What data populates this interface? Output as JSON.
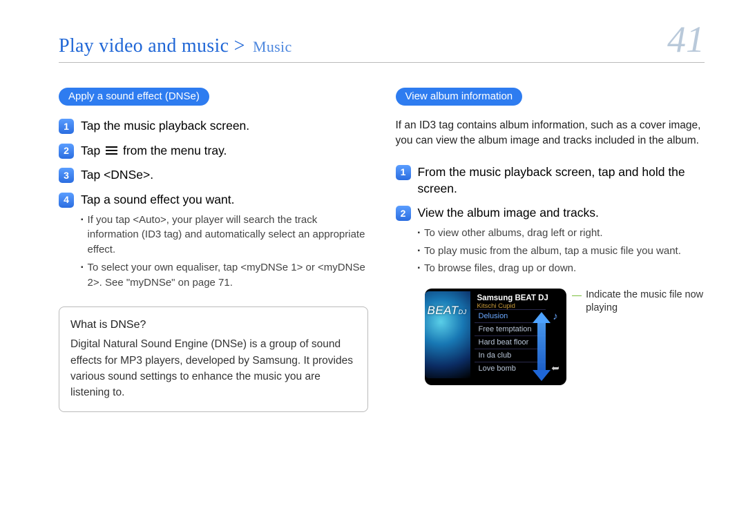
{
  "header": {
    "breadcrumb_main": "Play video and music >",
    "breadcrumb_sub": "Music",
    "page_number": "41"
  },
  "left": {
    "section_title": "Apply a sound effect (DNSe)",
    "steps": [
      {
        "text": "Tap the music playback screen."
      },
      {
        "pre": "Tap",
        "post": "from the menu tray.",
        "has_icon": true
      },
      {
        "text": "Tap <DNSe>."
      },
      {
        "text": "Tap a sound effect you want."
      }
    ],
    "step4_bullets": [
      "If you tap <Auto>, your player will search the track information (ID3 tag) and automatically select an appropriate effect.",
      "To select your own equaliser, tap <myDNSe 1> or <myDNSe 2>. See \"myDNSe\" on page 71."
    ],
    "note": {
      "title": "What is DNSe?",
      "body": "Digital Natural Sound Engine (DNSe) is a group of sound effects for MP3 players, developed by Samsung. It provides various sound settings to enhance the music you are listening to."
    }
  },
  "right": {
    "section_title": "View album information",
    "intro": "If an ID3 tag contains album information, such as a cover image, you can view the album image and tracks included in the album.",
    "steps": [
      {
        "text": "From the music playback screen, tap and hold the screen."
      },
      {
        "text": "View the album image and tracks."
      }
    ],
    "step2_bullets": [
      "To view other albums, drag left or right.",
      "To play music from the album, tap a music file you want.",
      "To browse files, drag up or down."
    ],
    "device": {
      "title": "Samsung BEAT DJ",
      "artist": "Kitschi Cupid",
      "logo": "BEAT",
      "logo_suffix": "DJ",
      "tracks": [
        "Delusion",
        "Free temptation",
        "Hard beat floor",
        "In da club",
        "Love bomb"
      ],
      "selected_index": 0
    },
    "callout": "Indicate the music file now playing"
  }
}
